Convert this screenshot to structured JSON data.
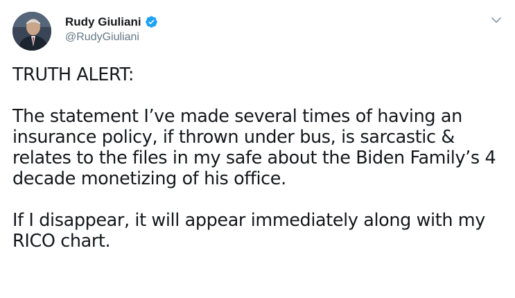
{
  "author": {
    "display_name": "Rudy Giuliani",
    "handle": "@RudyGiuliani",
    "verified": true
  },
  "icons": {
    "verified": "verified-badge-icon",
    "menu": "chevron-down-icon"
  },
  "colors": {
    "verified_blue": "#1da1f2",
    "text": "#14171a",
    "secondary": "#657786"
  },
  "tweet": {
    "text": "TRUTH ALERT:\n\nThe statement I’ve made several times of having an insurance policy, if thrown under bus, is sarcastic & relates to the files in my safe about the Biden Family’s 4 decade monetizing of his office.\n\nIf I disappear, it will appear immediately along with my RICO chart."
  }
}
